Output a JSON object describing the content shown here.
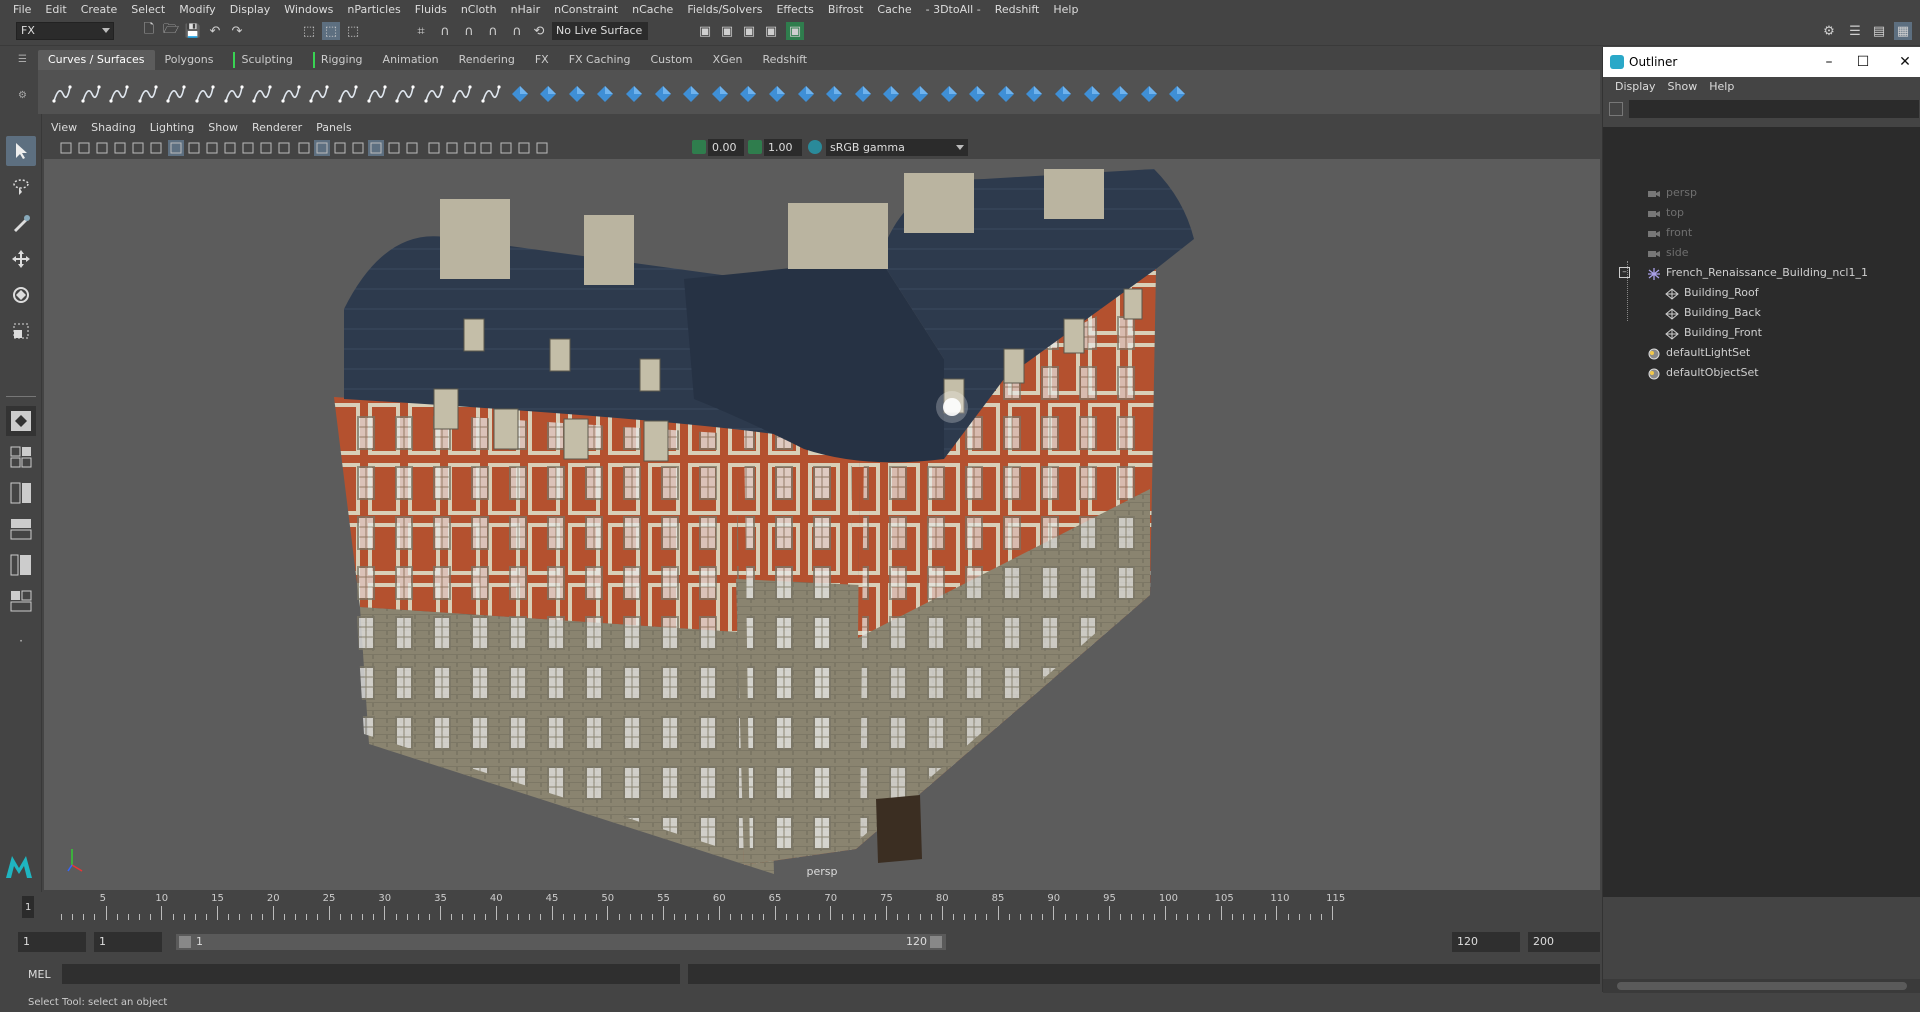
{
  "menubar": {
    "items": [
      "File",
      "Edit",
      "Create",
      "Select",
      "Modify",
      "Display",
      "Windows",
      "nParticles",
      "Fluids",
      "nCloth",
      "nHair",
      "nConstraint",
      "nCache",
      "Fields/Solvers",
      "Effects",
      "Bifrost",
      "Cache",
      "- 3DtoAll -",
      "Redshift",
      "Help"
    ]
  },
  "statusline": {
    "menuset": "FX",
    "live_surface": "No Live Surface"
  },
  "shelf": {
    "tabs": [
      "Curves / Surfaces",
      "Polygons",
      "Sculpting",
      "Rigging",
      "Animation",
      "Rendering",
      "FX",
      "FX Caching",
      "Custom",
      "XGen",
      "Redshift"
    ],
    "active_tab": "Curves / Surfaces"
  },
  "panel": {
    "menus": [
      "View",
      "Shading",
      "Lighting",
      "Show",
      "Renderer",
      "Panels"
    ],
    "exposure": "0.00",
    "gamma": "1.00",
    "color_space": "sRGB gamma",
    "camera_label": "persp"
  },
  "outliner": {
    "title": "Outliner",
    "menus": [
      "Display",
      "Show",
      "Help"
    ],
    "items": [
      {
        "label": "persp",
        "type": "camera",
        "dim": true
      },
      {
        "label": "top",
        "type": "camera",
        "dim": true
      },
      {
        "label": "front",
        "type": "camera",
        "dim": true
      },
      {
        "label": "side",
        "type": "camera",
        "dim": true
      },
      {
        "label": "French_Renaissance_Building_ncl1_1",
        "type": "group",
        "dim": false
      },
      {
        "label": "Building_Roof",
        "type": "mesh",
        "dim": false
      },
      {
        "label": "Building_Back",
        "type": "mesh",
        "dim": false
      },
      {
        "label": "Building_Front",
        "type": "mesh",
        "dim": false
      },
      {
        "label": "defaultLightSet",
        "type": "set",
        "dim": false
      },
      {
        "label": "defaultObjectSet",
        "type": "set",
        "dim": false
      }
    ]
  },
  "timeline": {
    "current_frame": "1",
    "tick_labels": [
      "5",
      "10",
      "15",
      "20",
      "25",
      "30",
      "35",
      "40",
      "45",
      "50",
      "55",
      "60",
      "65",
      "70",
      "75",
      "80",
      "85",
      "90",
      "95",
      "100",
      "105",
      "110",
      "115"
    ]
  },
  "range": {
    "start": "1",
    "playback_start": "1",
    "slider_start": "1",
    "slider_end": "120",
    "playback_end": "120",
    "end": "200"
  },
  "cmdline": {
    "label": "MEL"
  },
  "helpline": {
    "text": "Select Tool: select an object"
  },
  "colors": {
    "accent": "#5d6f80",
    "shelf_green": "#39d353",
    "viewport_bg": "#5c5c5c"
  }
}
